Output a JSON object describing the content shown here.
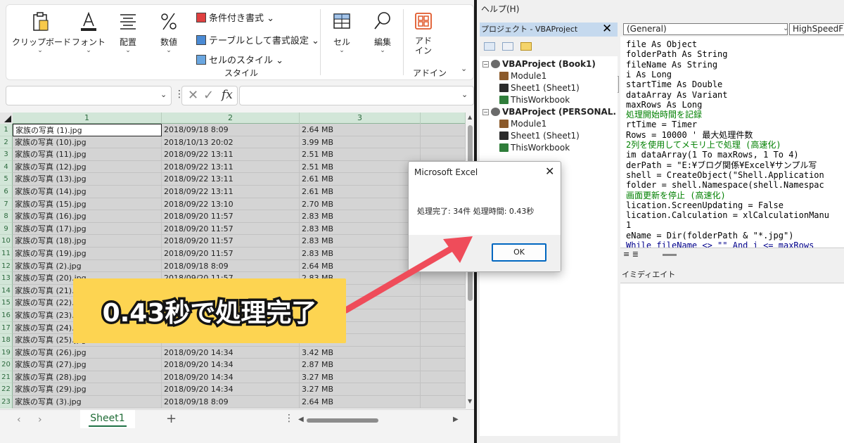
{
  "excel": {
    "ribbon": {
      "clipboard": "クリップボード",
      "font": "フォント",
      "alignment": "配置",
      "number": "数値",
      "conditional": "条件付き書式 ⌄",
      "table_format": "テーブルとして書式設定 ⌄",
      "cell_styles": "セルのスタイル ⌄",
      "styles_group": "スタイル",
      "cells": "セル",
      "editing": "編集",
      "addin": "アド\nイン",
      "addin_group": "アドイン",
      "chevron": "⌄",
      "collapse": "⌄"
    },
    "formula_bar": {
      "namebox_value": "",
      "namebox_arrow": "⌄",
      "dots": "⋮",
      "cancel": "✕",
      "enter": "✓",
      "fx": "fx",
      "value": "",
      "expand": "⌄"
    },
    "columns": [
      "1",
      "2",
      "3",
      ""
    ],
    "rows": [
      {
        "n": "1",
        "name": "家族の写真 (1).jpg",
        "date": "2018/09/18 8:09",
        "size": "2.64 MB"
      },
      {
        "n": "2",
        "name": "家族の写真 (10).jpg",
        "date": "2018/10/13 20:02",
        "size": "3.99 MB"
      },
      {
        "n": "3",
        "name": "家族の写真 (11).jpg",
        "date": "2018/09/22 13:11",
        "size": "2.51 MB"
      },
      {
        "n": "4",
        "name": "家族の写真 (12).jpg",
        "date": "2018/09/22 13:11",
        "size": "2.51 MB"
      },
      {
        "n": "5",
        "name": "家族の写真 (13).jpg",
        "date": "2018/09/22 13:11",
        "size": "2.61 MB"
      },
      {
        "n": "6",
        "name": "家族の写真 (14).jpg",
        "date": "2018/09/22 13:11",
        "size": "2.61 MB"
      },
      {
        "n": "7",
        "name": "家族の写真 (15).jpg",
        "date": "2018/09/22 13:10",
        "size": "2.70 MB"
      },
      {
        "n": "8",
        "name": "家族の写真 (16).jpg",
        "date": "2018/09/20 11:57",
        "size": "2.83 MB"
      },
      {
        "n": "9",
        "name": "家族の写真 (17).jpg",
        "date": "2018/09/20 11:57",
        "size": "2.83 MB"
      },
      {
        "n": "10",
        "name": "家族の写真 (18).jpg",
        "date": "2018/09/20 11:57",
        "size": "2.83 MB"
      },
      {
        "n": "11",
        "name": "家族の写真 (19).jpg",
        "date": "2018/09/20 11:57",
        "size": "2.83 MB"
      },
      {
        "n": "12",
        "name": "家族の写真 (2).jpg",
        "date": "2018/09/18 8:09",
        "size": "2.64 MB"
      },
      {
        "n": "13",
        "name": "家族の写真 (20).jpg",
        "date": "2018/09/20 11:57",
        "size": "2.83 MB"
      },
      {
        "n": "14",
        "name": "家族の写真 (21).jpg",
        "date": "",
        "size": ""
      },
      {
        "n": "15",
        "name": "家族の写真 (22).jpg",
        "date": "",
        "size": ""
      },
      {
        "n": "16",
        "name": "家族の写真 (23).jpg",
        "date": "",
        "size": ""
      },
      {
        "n": "17",
        "name": "家族の写真 (24).jpg",
        "date": "",
        "size": ""
      },
      {
        "n": "18",
        "name": "家族の写真 (25).jpg",
        "date": "",
        "size": ""
      },
      {
        "n": "19",
        "name": "家族の写真 (26).jpg",
        "date": "2018/09/20 14:34",
        "size": "3.42 MB"
      },
      {
        "n": "20",
        "name": "家族の写真 (27).jpg",
        "date": "2018/09/20 14:34",
        "size": "2.87 MB"
      },
      {
        "n": "21",
        "name": "家族の写真 (28).jpg",
        "date": "2018/09/20 14:34",
        "size": "3.27 MB"
      },
      {
        "n": "22",
        "name": "家族の写真 (29).jpg",
        "date": "2018/09/20 14:34",
        "size": "3.27 MB"
      },
      {
        "n": "23",
        "name": "家族の写真 (3).jpg",
        "date": "2018/09/18 8:09",
        "size": "2.64 MB"
      }
    ],
    "tabs": {
      "prev": "‹",
      "next": "›",
      "active": "Sheet1",
      "add": "+",
      "dots": "⋮",
      "scroll_left": "◀",
      "scroll_right": "▶"
    },
    "scroll": {
      "up": "▲",
      "down": "▼"
    }
  },
  "vbe": {
    "menu": "ヘルプ(H)",
    "project_title": "プロジェクト - VBAProject",
    "project_close": "✕",
    "tree": [
      {
        "label": "VBAProject (Book1)",
        "level": 0,
        "kind": "project"
      },
      {
        "label": "Module1",
        "level": 1,
        "kind": "module"
      },
      {
        "label": "Sheet1 (Sheet1)",
        "level": 1,
        "kind": "sheet"
      },
      {
        "label": "ThisWorkbook",
        "level": 1,
        "kind": "workbook"
      },
      {
        "label": "VBAProject (PERSONAL.",
        "level": 0,
        "kind": "project"
      },
      {
        "label": "Module1",
        "level": 1,
        "kind": "module"
      },
      {
        "label": "Sheet1 (Sheet1)",
        "level": 1,
        "kind": "sheet"
      },
      {
        "label": "ThisWorkbook",
        "level": 1,
        "kind": "workbook"
      }
    ],
    "tree_expand": "−",
    "combo_general": "(General)",
    "combo_general_arrow": "⌄",
    "combo_proc": "HighSpeedF",
    "code_lines": [
      {
        "text": "  file As Object",
        "cls": ""
      },
      {
        "text": "  folderPath As String",
        "cls": ""
      },
      {
        "text": "  fileName As String",
        "cls": ""
      },
      {
        "text": "  i As Long",
        "cls": ""
      },
      {
        "text": "  startTime As Double",
        "cls": ""
      },
      {
        "text": "  dataArray As Variant",
        "cls": ""
      },
      {
        "text": "  maxRows As Long",
        "cls": ""
      },
      {
        "text": "処理開始時間を記録",
        "cls": "cm"
      },
      {
        "text": "rtTime = Timer",
        "cls": ""
      },
      {
        "text": "Rows = 10000 ' 最大処理件数",
        "cls": ""
      },
      {
        "text": "2列を使用してメモリ上で処理 (高速化)",
        "cls": "cm"
      },
      {
        "text": "im dataArray(1 To maxRows, 1 To 4)",
        "cls": ""
      },
      {
        "text": "derPath = \"E:¥ブログ関係¥Excel¥サンプル写",
        "cls": ""
      },
      {
        "text": " shell = CreateObject(\"Shell.Application",
        "cls": ""
      },
      {
        "text": " folder = shell.Namespace(shell.Namespac",
        "cls": ""
      },
      {
        "text": "画面更新を停止 (高速化)",
        "cls": "cm"
      },
      {
        "text": "lication.ScreenUpdating = False",
        "cls": ""
      },
      {
        "text": "lication.Calculation = xlCalculationManu",
        "cls": ""
      },
      {
        "text": " 1",
        "cls": ""
      },
      {
        "text": "eName = Dir(folderPath & \"*.jpg\")",
        "cls": ""
      },
      {
        "text": "While fileName <> \"\" And i <= maxRows",
        "cls": "kw"
      }
    ],
    "view_buttons": "≡ ≣",
    "immediate_title": "イミディエイト"
  },
  "msgbox": {
    "title": "Microsoft Excel",
    "close": "✕",
    "text": "処理完了: 34件 処理時間: 0.43秒",
    "ok": "OK"
  },
  "callout": {
    "text": "0.43秒で処理完了",
    "color": "#fdd451",
    "arrow_color": "#ef4c5a"
  }
}
